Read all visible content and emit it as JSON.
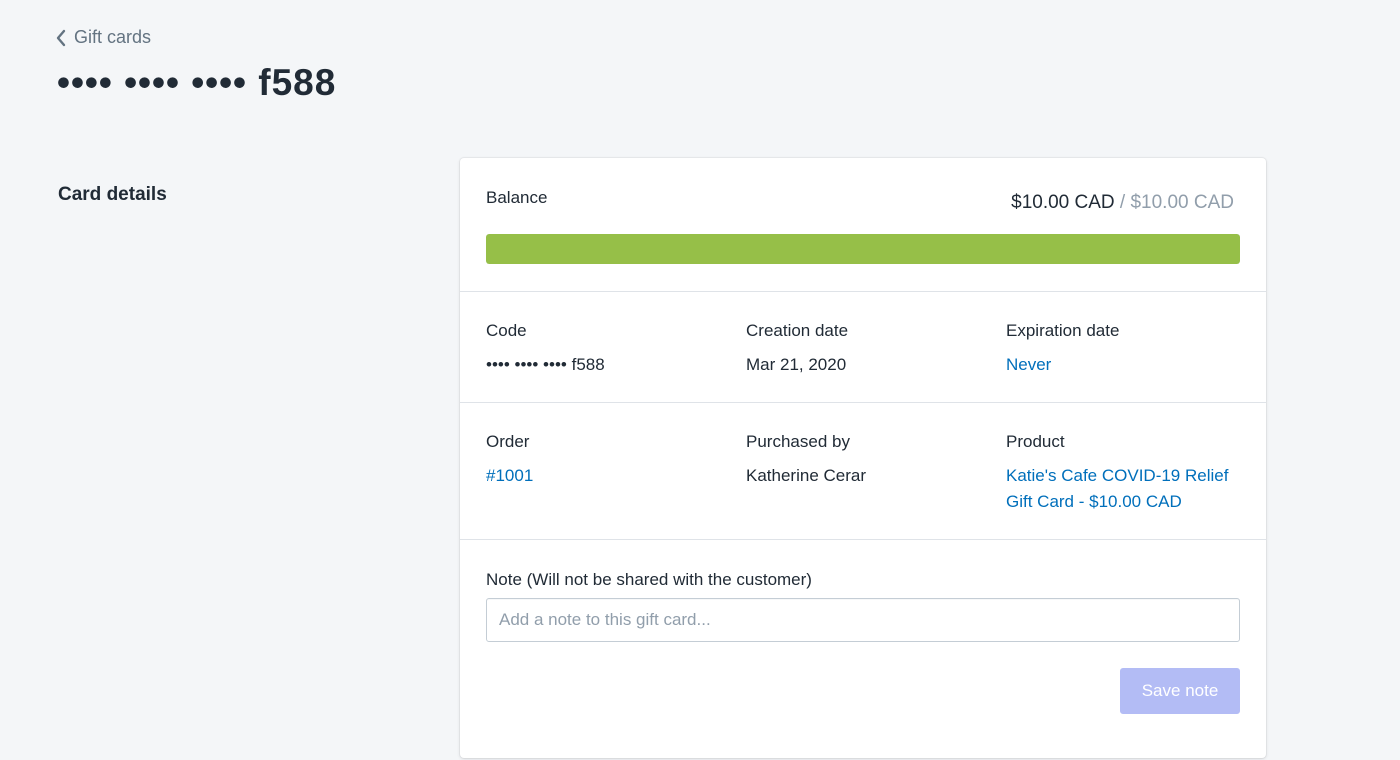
{
  "breadcrumb": {
    "label": "Gift cards"
  },
  "page": {
    "title": "•••• •••• •••• f588"
  },
  "section": {
    "title": "Card details"
  },
  "balance": {
    "label": "Balance",
    "current": "$10.00 CAD",
    "separator": "/",
    "initial": "$10.00 CAD",
    "progress_fraction": 1.0,
    "bar_color": "#96bf48"
  },
  "details": {
    "code_label": "Code",
    "code_value": "•••• •••• •••• f588",
    "creation_label": "Creation date",
    "creation_value": "Mar 21, 2020",
    "expiration_label": "Expiration date",
    "expiration_value": "Never",
    "order_label": "Order",
    "order_value": "#1001",
    "purchased_label": "Purchased by",
    "purchased_value": "Katherine Cerar",
    "product_label": "Product",
    "product_value": "Katie's Cafe COVID-19 Relief Gift Card - $10.00 CAD"
  },
  "note": {
    "label": "Note (Will not be shared with the customer)",
    "placeholder": "Add a note to this gift card...",
    "value": "",
    "save_label": "Save note"
  },
  "colors": {
    "link": "#006fbb",
    "background": "#f4f6f8",
    "save_button_disabled": "#b3bcf5"
  },
  "icons": {
    "back": "chevron-left-icon"
  }
}
